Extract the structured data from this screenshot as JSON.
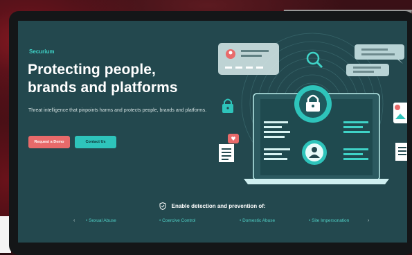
{
  "hero": {
    "brand": "Securium",
    "headline": "Protecting people, brands and platforms",
    "subtext": "Threat intelligence that pinpoints harms and protects people, brands and platforms.",
    "buttons": {
      "demo": "Request a Demo",
      "contact": "Contact Us"
    }
  },
  "detection": {
    "heading": "Enable detection and prevention of:",
    "topics": [
      "Sexual Abuse",
      "Coercive Control",
      "Domestic Abuse",
      "Site Impersonation"
    ],
    "prev_arrow": "‹",
    "next_arrow": "›"
  },
  "colors": {
    "screen_bg": "#23484e",
    "accent": "#3fd3c7",
    "demo_button": "#e86a6a",
    "contact_button": "#2ec4bb"
  },
  "icons": [
    "lock-icon",
    "magnifier-icon",
    "chat-bubble-icon",
    "user-icon",
    "heart-icon",
    "document-icon",
    "shield-icon"
  ]
}
